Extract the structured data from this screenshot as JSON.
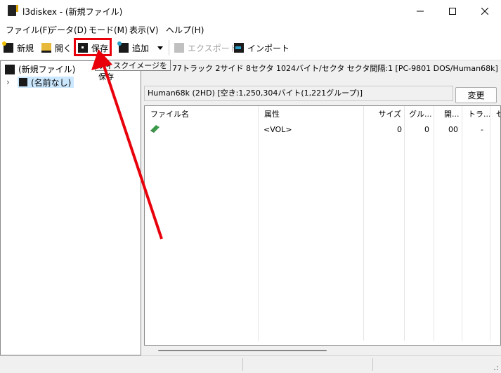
{
  "window": {
    "title": "l3diskex - (新規ファイル)"
  },
  "menu": [
    "ファイル(F)",
    "データ(D)",
    "モード(M)",
    "表示(V)",
    "ヘルプ(H)"
  ],
  "toolbar": {
    "new_label": "新規",
    "open_label": "開く",
    "save_label": "保存",
    "add_label": "追加",
    "export_label": "エクスポート",
    "import_label": "インポート",
    "save_tooltip": "ディスクイメージを保存"
  },
  "tree": {
    "root_label": "(新規ファイル)",
    "child_label": "(名前なし)"
  },
  "disk_info": "77トラック 2サイド 8セクタ 1024バイト/セクタ セクタ間隔:1 [PC-9801 DOS/Human68k]",
  "partition": {
    "label": "Human68k (2HD) [空き:1,250,304バイト(1,221グループ)]",
    "change_button": "変更"
  },
  "table": {
    "columns": [
      "ファイル名",
      "属性",
      "サイズ",
      "グル...",
      "開...",
      "トラ...",
      "セ"
    ],
    "rows": [
      {
        "name": "",
        "attr": "<VOL>",
        "size": "0",
        "group": "0",
        "start": "00",
        "track": "-"
      }
    ]
  },
  "colors": {
    "annotation": "#e8000b",
    "accent": "#0078d7"
  }
}
